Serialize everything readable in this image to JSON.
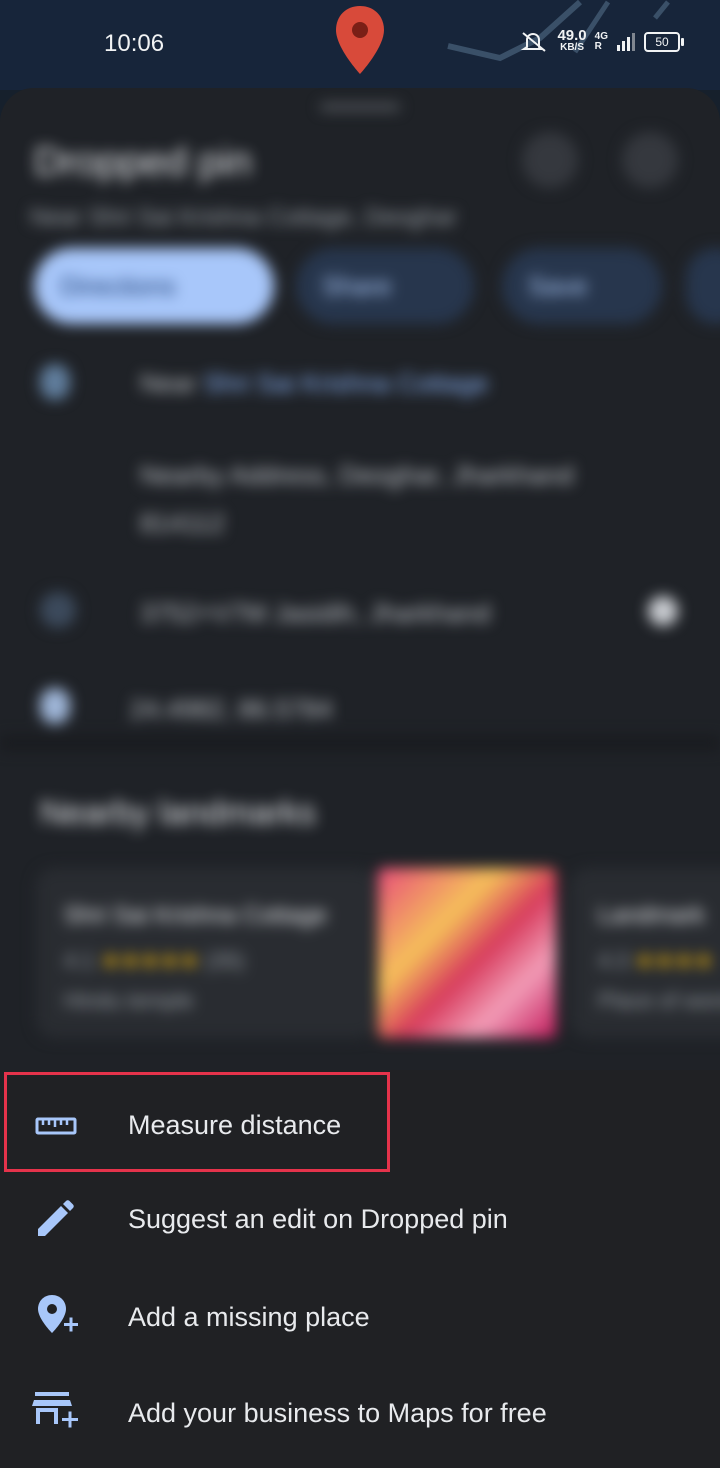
{
  "status_bar": {
    "time": "10:06",
    "net_speed_value": "49.0",
    "net_speed_unit": "KB/S",
    "net_type_top": "4G",
    "net_type_bottom": "R",
    "battery": "50",
    "icons": [
      "mute-icon",
      "signal-icon",
      "battery-icon"
    ]
  },
  "background_sheet": {
    "title": "Dropped pin",
    "subtitle": "Near Shri Sai Krishna Cottage, Deoghar",
    "chips": [
      "Directions",
      "Share",
      "Save"
    ],
    "address_prefix": "Near",
    "address_link": "Shri Sai Krishna Cottage",
    "nearby_address_line1": "Nearby Address, Deoghar, Jharkhand",
    "nearby_address_line2": "814112",
    "plus_code": "3752+V7M Jasidih, Jharkhand",
    "coordinates": "24.4982, 86.5784",
    "section_title": "Nearby landmarks",
    "card1_title": "Shri Sai Krishna Cottage",
    "card1_rating": "4.1",
    "card1_stars": "★★★★★",
    "card1_reviews": "(35)",
    "card1_category": "Hindu temple",
    "card2_title": "Landmark",
    "card2_rating": "4.3",
    "card2_stars": "★★★★",
    "card2_category": "Place of worship"
  },
  "menu": {
    "items": [
      {
        "label": "Measure distance",
        "icon": "ruler-icon"
      },
      {
        "label": "Suggest an edit on Dropped pin",
        "icon": "pencil-icon"
      },
      {
        "label": "Add a missing place",
        "icon": "add-place-icon"
      },
      {
        "label": "Add your business to Maps for free",
        "icon": "add-business-icon"
      }
    ]
  },
  "colors": {
    "menu_bg": "#202124",
    "icon_blue": "#a8c7fa",
    "highlight_red": "#e5334b",
    "pin_red": "#d84a3a"
  }
}
